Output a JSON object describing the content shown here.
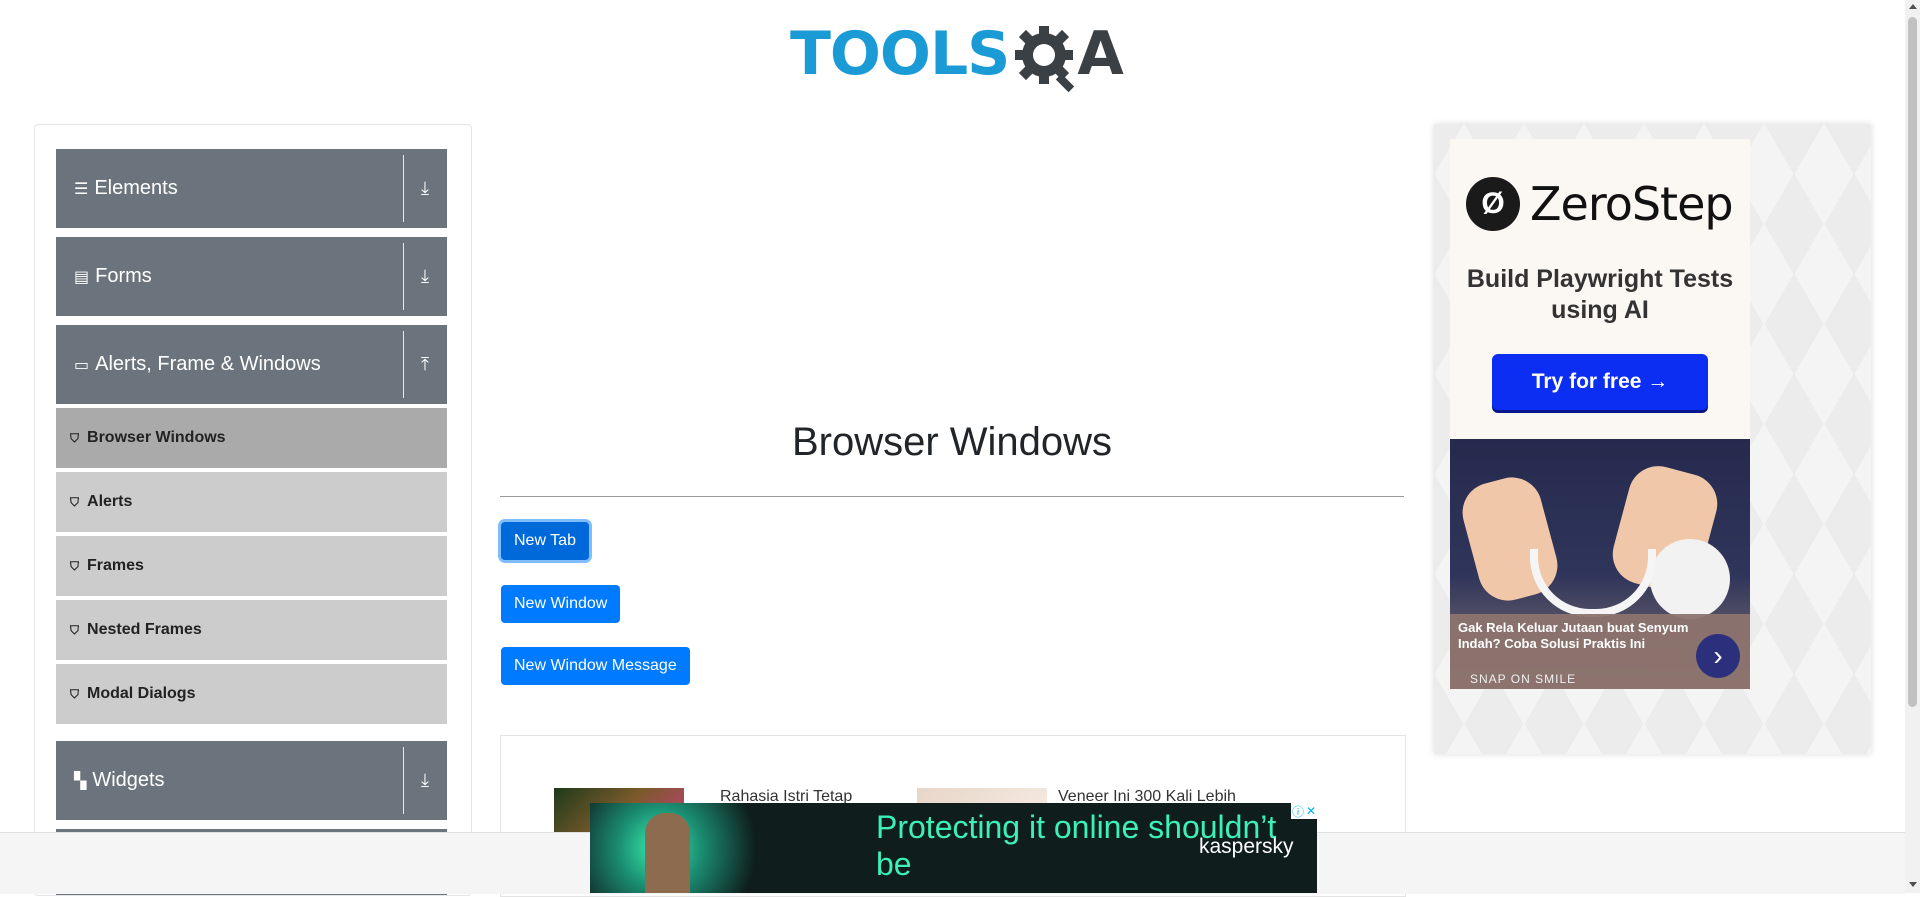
{
  "header": {
    "logo_part1": "TOOLS",
    "logo_part2": "A"
  },
  "sidebar": {
    "groups": [
      {
        "label": "Elements",
        "icon": "hamburger-icon",
        "toggle_icon": "download-arrow-icon"
      },
      {
        "label": "Forms",
        "icon": "document-icon",
        "toggle_icon": "download-arrow-icon"
      },
      {
        "label": "Alerts, Frame & Windows",
        "icon": "window-icon",
        "toggle_icon": "upload-arrow-icon"
      },
      {
        "label": "Widgets",
        "icon": "grid-icon",
        "toggle_icon": "download-arrow-icon"
      }
    ],
    "items": [
      {
        "label": "Browser Windows",
        "active": true
      },
      {
        "label": "Alerts"
      },
      {
        "label": "Frames"
      },
      {
        "label": "Nested Frames"
      },
      {
        "label": "Modal Dialogs"
      }
    ]
  },
  "main": {
    "title": "Browser Windows",
    "buttons": {
      "new_tab": "New Tab",
      "new_window": "New Window",
      "new_window_message": "New Window Message"
    },
    "news": [
      {
        "text": "Rahasia Istri Tetap"
      },
      {
        "text": "Veneer Ini 300 Kali Lebih"
      }
    ]
  },
  "ad_right": {
    "brand": "ZeroStep",
    "headline": "Build Playwright Tests using AI",
    "cta": "Try for free →",
    "caption": "Gak Rela Keluar Jutaan buat Senyum Indah? Coba Solusi Praktis Ini",
    "sponsor": "SNAP ON SMILE"
  },
  "ad_bottom": {
    "message": "Protecting it online shouldn’t be",
    "brand": "kaspersky"
  },
  "colors": {
    "primary": "#007bff",
    "sidebar_group": "#6b747c",
    "sidebar_item": "#cccccc",
    "sidebar_item_active": "#aaaaaa",
    "logo_blue": "#1b9bd6"
  }
}
